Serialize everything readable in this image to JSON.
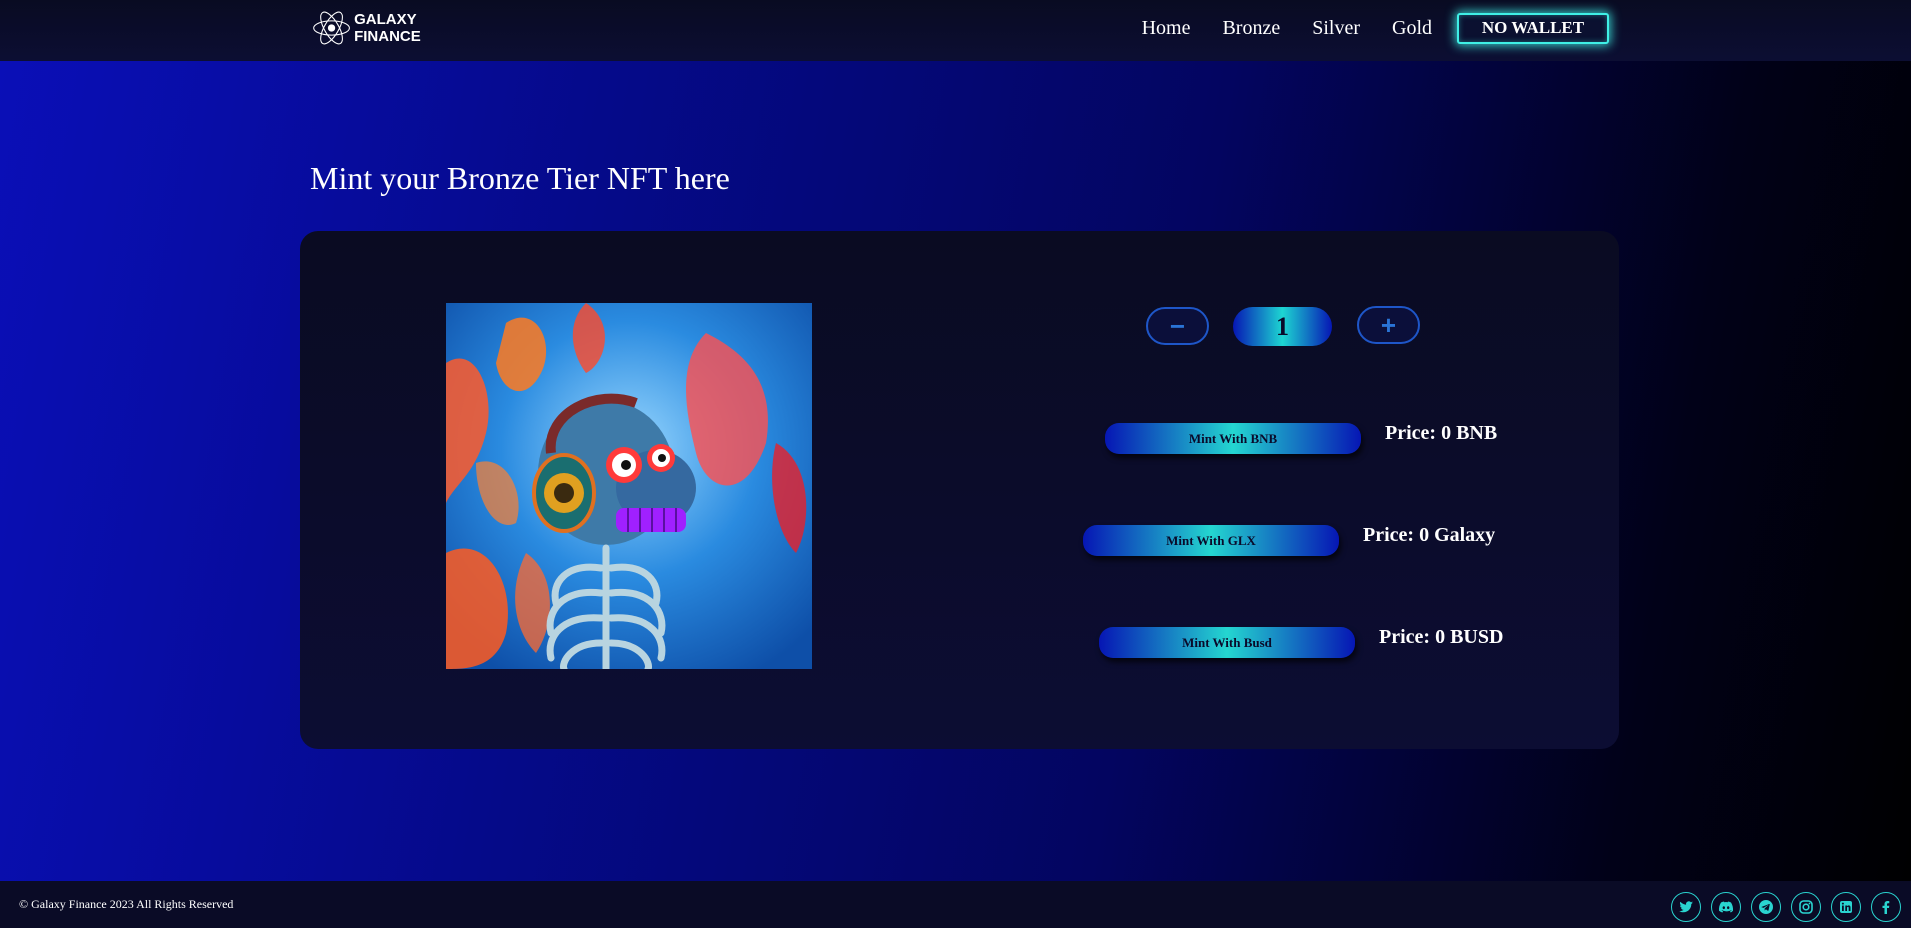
{
  "header": {
    "logo_text": "GALAXY FINANCE",
    "nav": [
      "Home",
      "Bronze",
      "Silver",
      "Gold"
    ],
    "wallet_label": "NO WALLET"
  },
  "main": {
    "title": "Mint your Bronze Tier NFT here",
    "stepper": {
      "minus_label": "−",
      "value": "1",
      "plus_label": "+"
    },
    "mint_options": [
      {
        "button": "Mint With BNB",
        "price": "Price: 0 BNB"
      },
      {
        "button": "Mint With GLX",
        "price": "Price: 0 Galaxy"
      },
      {
        "button": "Mint With Busd",
        "price": "Price: 0 BUSD"
      }
    ]
  },
  "footer": {
    "copyright": "© Galaxy Finance 2023 All Rights Reserved",
    "socials": [
      "twitter-icon",
      "discord-icon",
      "telegram-icon",
      "instagram-icon",
      "linkedin-icon",
      "facebook-icon"
    ]
  },
  "colors": {
    "accent": "#2ad4d0",
    "background_start": "#0a0fb8",
    "background_end": "#000000",
    "card": "#0b0c28"
  }
}
